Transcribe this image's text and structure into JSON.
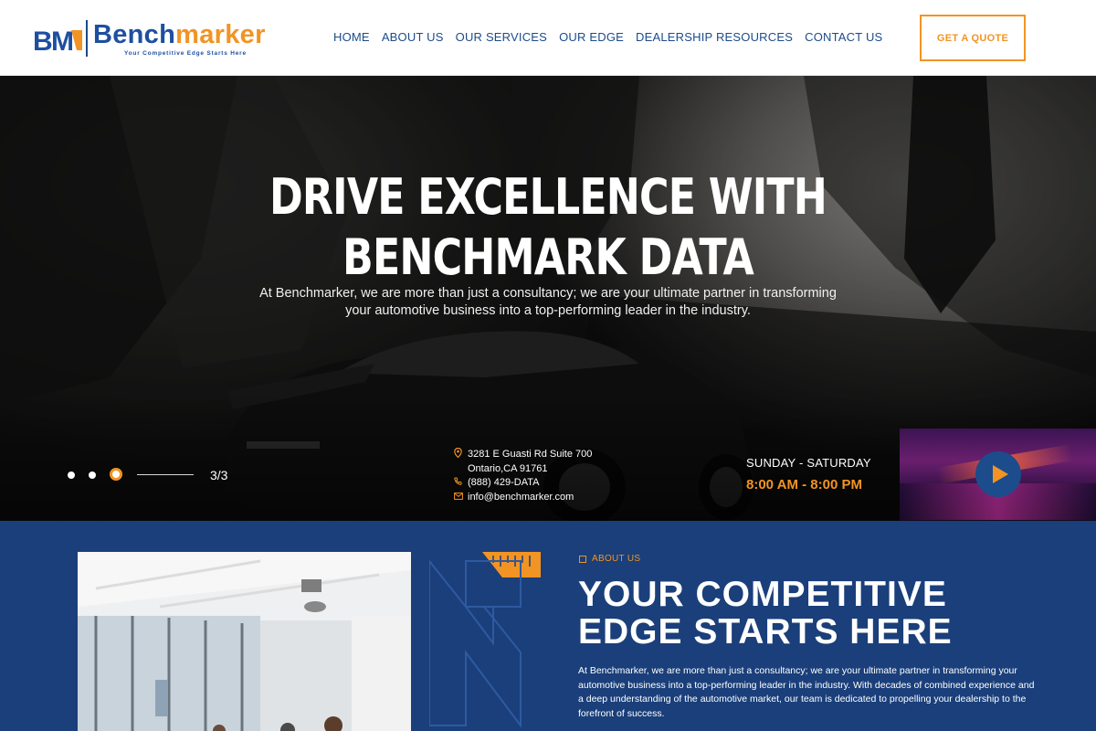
{
  "header": {
    "logo_word_b": "Bench",
    "logo_word_m": "marker",
    "logo_tagline": "Your Competitive Edge Starts Here",
    "nav": [
      {
        "label": "HOME"
      },
      {
        "label": "ABOUT US"
      },
      {
        "label": "OUR SERVICES"
      },
      {
        "label": "OUR EDGE"
      },
      {
        "label": "DEALERSHIP RESOURCES"
      },
      {
        "label": "CONTACT US"
      }
    ],
    "cta_label": "GET A QUOTE"
  },
  "hero": {
    "title_line1": "DRIVE EXCELLENCE WITH",
    "title_line2": "BENCHMARK DATA",
    "subtitle": "At Benchmarker, we are more than just a consultancy; we are your ultimate partner in transforming your automotive business into a top-performing leader in the industry.",
    "slide_counter": "3/3",
    "current_slide": 3,
    "total_slides": 3
  },
  "contact": {
    "address_line1": "3281 E Guasti Rd Suite 700",
    "address_line2": "Ontario,CA 91761",
    "phone": "(888) 429-DATA",
    "email": "info@benchmarker.com"
  },
  "hours": {
    "days": "SUNDAY - SATURDAY",
    "time": "8:00 AM - 8:00 PM"
  },
  "about": {
    "label": "ABOUT US",
    "title_line1": "YOUR COMPETITIVE",
    "title_line2": "EDGE STARTS HERE",
    "body": "At Benchmarker, we are more than just a consultancy; we are your ultimate partner in transforming your automotive business into a top-performing leader in the industry. With decades of combined experience and a deep understanding of the automotive market, our team is dedicated to propelling your dealership to the forefront of success."
  },
  "colors": {
    "brand_blue": "#1e4fa0",
    "brand_orange": "#f29423",
    "about_bg": "#1a3f7a"
  }
}
